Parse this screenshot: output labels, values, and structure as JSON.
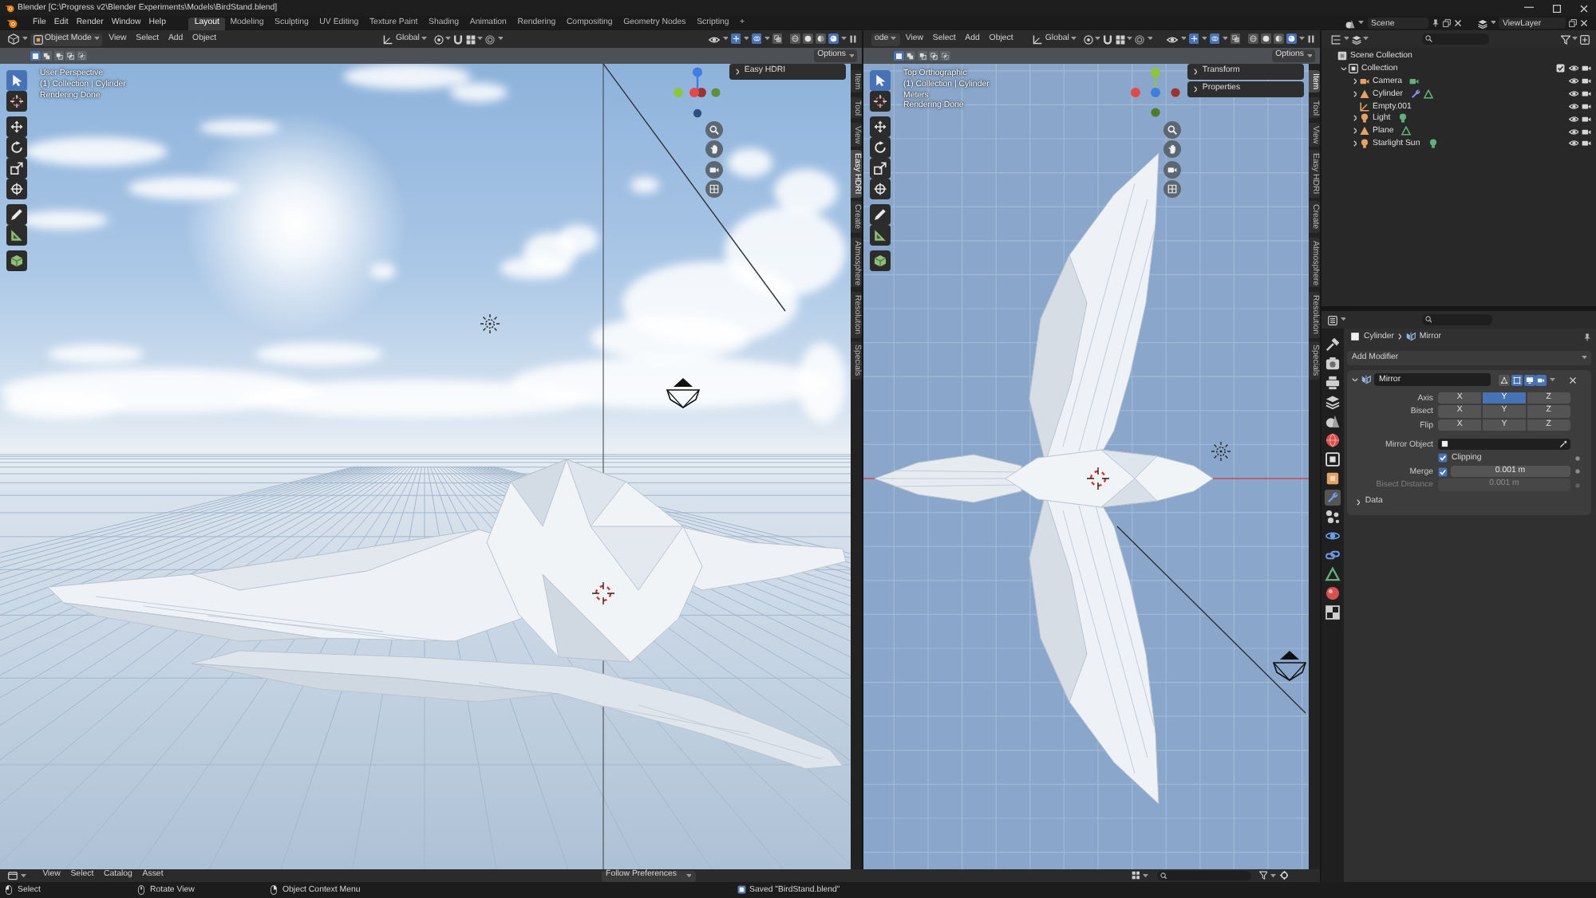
{
  "window": {
    "title": "Blender [C:\\Progress v2\\Blender Experiments\\Models\\BirdStand.blend]"
  },
  "menu": [
    "File",
    "Edit",
    "Render",
    "Window",
    "Help"
  ],
  "workspaces": [
    {
      "label": "Layout",
      "selected": true
    },
    {
      "label": "Modeling",
      "selected": false
    },
    {
      "label": "Sculpting",
      "selected": false
    },
    {
      "label": "UV Editing",
      "selected": false
    },
    {
      "label": "Texture Paint",
      "selected": false
    },
    {
      "label": "Shading",
      "selected": false
    },
    {
      "label": "Animation",
      "selected": false
    },
    {
      "label": "Rendering",
      "selected": false
    },
    {
      "label": "Compositing",
      "selected": false
    },
    {
      "label": "Geometry Nodes",
      "selected": false
    },
    {
      "label": "Scripting",
      "selected": false
    }
  ],
  "add_workspace": "+",
  "scene": "Scene",
  "view_layer": "ViewLayer",
  "viewports": [
    {
      "kind": "perspective",
      "editor_icon": true,
      "mode": "Object Mode",
      "menus": [
        "View",
        "Select",
        "Add",
        "Object"
      ],
      "orientation": "Global",
      "toggles": [
        {
          "kind": "gizmo",
          "on": true
        },
        {
          "kind": "overlay",
          "on": true
        },
        {
          "kind": "xray",
          "on": false
        }
      ],
      "shading": [
        {
          "kind": "wireframe",
          "selected": false
        },
        {
          "kind": "solid",
          "selected": false
        },
        {
          "kind": "material",
          "selected": false
        },
        {
          "kind": "rendered",
          "selected": true
        }
      ],
      "select_modes": [
        {
          "kind": "set",
          "selected": true
        },
        {
          "kind": "extend",
          "selected": false
        },
        {
          "kind": "subtract",
          "selected": false
        },
        {
          "kind": "invert",
          "selected": false
        },
        {
          "kind": "intersect",
          "selected": false
        }
      ],
      "options": "Options",
      "tools": [
        {
          "kind": "select_box",
          "selected": true
        },
        {
          "kind": "cursor",
          "selected": false
        },
        {
          "kind": "move",
          "selected": false
        },
        {
          "kind": "rotate",
          "selected": false
        },
        {
          "kind": "scale",
          "selected": false
        },
        {
          "kind": "transform",
          "selected": false
        },
        {
          "kind": "annotate",
          "selected": false
        },
        {
          "kind": "measure",
          "selected": false
        },
        {
          "kind": "add_cube",
          "selected": false
        }
      ],
      "overlay_text": [
        "User Perspective",
        "(1) Collection | Cylinder",
        "Rendering Done"
      ],
      "panels": [
        {
          "label": "Easy HDRI",
          "expanded": false
        }
      ],
      "tabs": [
        {
          "label": "Item",
          "selected": false
        },
        {
          "label": "Tool",
          "selected": false
        },
        {
          "label": "View",
          "selected": false
        },
        {
          "label": "Easy HDRI",
          "selected": true
        },
        {
          "label": "Create",
          "selected": false
        },
        {
          "label": "Atmosphere",
          "selected": false
        },
        {
          "label": "Resolution",
          "selected": false
        },
        {
          "label": "Specials",
          "selected": false
        }
      ]
    },
    {
      "kind": "top",
      "editor_icon": false,
      "mode": "ode",
      "menus": [
        "View",
        "Select",
        "Add",
        "Object"
      ],
      "orientation": "Global",
      "toggles": [
        {
          "kind": "gizmo",
          "on": true
        },
        {
          "kind": "overlay",
          "on": true
        },
        {
          "kind": "xray",
          "on": false
        }
      ],
      "shading": [
        {
          "kind": "wireframe",
          "selected": false
        },
        {
          "kind": "solid",
          "selected": false
        },
        {
          "kind": "material",
          "selected": false
        },
        {
          "kind": "rendered",
          "selected": true
        }
      ],
      "select_modes": [
        {
          "kind": "set",
          "selected": true
        },
        {
          "kind": "extend",
          "selected": false
        },
        {
          "kind": "subtract",
          "selected": false
        },
        {
          "kind": "invert",
          "selected": false
        },
        {
          "kind": "intersect",
          "selected": false
        }
      ],
      "options": "Options",
      "tools": [
        {
          "kind": "select_box",
          "selected": true
        },
        {
          "kind": "cursor",
          "selected": false
        },
        {
          "kind": "move",
          "selected": false
        },
        {
          "kind": "rotate",
          "selected": false
        },
        {
          "kind": "scale",
          "selected": false
        },
        {
          "kind": "transform",
          "selected": false
        },
        {
          "kind": "annotate",
          "selected": false
        },
        {
          "kind": "measure",
          "selected": false
        },
        {
          "kind": "add_cube",
          "selected": false
        }
      ],
      "overlay_text": [
        "Top Orthographic",
        "(1) Collection | Cylinder",
        "Meters",
        "Rendering Done"
      ],
      "panels": [
        {
          "label": "Transform",
          "expanded": false
        },
        {
          "label": "Properties",
          "expanded": false
        }
      ],
      "tabs": [
        {
          "label": "Item",
          "selected": true
        },
        {
          "label": "Tool",
          "selected": false
        },
        {
          "label": "View",
          "selected": false
        },
        {
          "label": "Easy HDRI",
          "selected": false
        },
        {
          "label": "Create",
          "selected": false
        },
        {
          "label": "Atmosphere",
          "selected": false
        },
        {
          "label": "Resolution",
          "selected": false
        },
        {
          "label": "Specials",
          "selected": false
        }
      ]
    }
  ],
  "outliner": {
    "tree": [
      {
        "label": "Scene Collection",
        "kind": "scene_collection",
        "children": [
          {
            "label": "Collection",
            "kind": "collection",
            "expanded": true,
            "included": true,
            "visible": true,
            "renderable": true,
            "children": [
              {
                "label": "Camera",
                "kind": "camera",
                "expanded": false,
                "modifier": false,
                "visible": true,
                "renderable": true
              },
              {
                "label": "Cylinder",
                "kind": "mesh",
                "expanded": false,
                "modifier": true,
                "visible": true,
                "renderable": true
              },
              {
                "label": "Empty.001",
                "kind": "empty",
                "modifier": false,
                "visible": true,
                "renderable": true
              },
              {
                "label": "Light",
                "kind": "light",
                "expanded": false,
                "modifier": false,
                "visible": true,
                "renderable": true
              },
              {
                "label": "Plane",
                "kind": "mesh",
                "expanded": false,
                "modifier": false,
                "visible": true,
                "renderable": true
              },
              {
                "label": "Starlight Sun",
                "kind": "light",
                "expanded": false,
                "modifier": false,
                "visible": true,
                "renderable": true
              }
            ]
          }
        ]
      }
    ]
  },
  "properties": {
    "tabs": [
      {
        "kind": "tool",
        "selected": false
      },
      {
        "kind": "render",
        "selected": false
      },
      {
        "kind": "output",
        "selected": false
      },
      {
        "kind": "view_layer",
        "selected": false
      },
      {
        "kind": "scene",
        "selected": false
      },
      {
        "kind": "world",
        "selected": false
      },
      {
        "kind": "collection",
        "selected": false
      },
      {
        "kind": "object",
        "selected": false
      },
      {
        "kind": "modifiers",
        "selected": true
      },
      {
        "kind": "particles",
        "selected": false
      },
      {
        "kind": "physics",
        "selected": false
      },
      {
        "kind": "constraints",
        "selected": false
      },
      {
        "kind": "data",
        "selected": false
      },
      {
        "kind": "material",
        "selected": false
      },
      {
        "kind": "texture",
        "selected": false
      }
    ],
    "breadcrumb": [
      "Cylinder",
      "Mirror"
    ],
    "add_modifier": "Add Modifier",
    "modifier": {
      "name": "Mirror",
      "expanded": true,
      "toggles": [
        {
          "kind": "on_cage",
          "on": false
        },
        {
          "kind": "edit_mode",
          "on": true
        },
        {
          "kind": "viewport",
          "on": true
        },
        {
          "kind": "render",
          "on": true
        }
      ],
      "axis_rows": [
        {
          "label": "Axis",
          "options": [
            {
              "label": "X",
              "selected": false
            },
            {
              "label": "Y",
              "selected": true
            },
            {
              "label": "Z",
              "selected": false
            }
          ]
        },
        {
          "label": "Bisect",
          "options": [
            {
              "label": "X",
              "selected": false
            },
            {
              "label": "Y",
              "selected": false
            },
            {
              "label": "Z",
              "selected": false
            }
          ]
        },
        {
          "label": "Flip",
          "options": [
            {
              "label": "X",
              "selected": false
            },
            {
              "label": "Y",
              "selected": false
            },
            {
              "label": "Z",
              "selected": false
            }
          ]
        }
      ],
      "mirror_object": {
        "label": "Mirror Object"
      },
      "clipping": {
        "label": "Clipping",
        "checked": true
      },
      "merge": {
        "label": "Merge",
        "checked": true,
        "value": "0.001 m"
      },
      "bisect_distance": {
        "label": "Bisect Distance",
        "value": "0.001 m",
        "disabled": true
      },
      "subpanels": [
        {
          "label": "Data",
          "expanded": false
        }
      ]
    }
  },
  "asset_browser": {
    "menus": [
      "View",
      "Select",
      "Catalog",
      "Asset"
    ],
    "library": "Follow Preferences"
  },
  "status_bar": {
    "hints": [
      {
        "kind": "left_click",
        "label": "Select"
      },
      {
        "kind": "middle_click",
        "label": "Rotate View"
      },
      {
        "kind": "right_click",
        "label": "Object Context Menu"
      }
    ],
    "message": "Saved \"BirdStand.blend\""
  }
}
